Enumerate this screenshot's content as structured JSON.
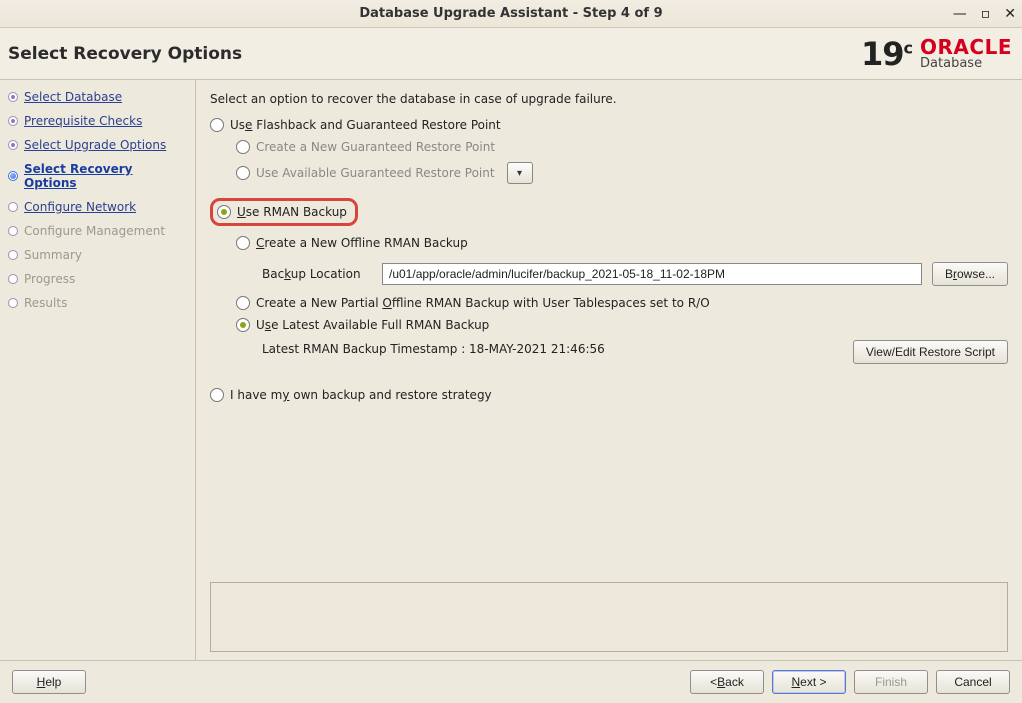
{
  "window": {
    "title": "Database Upgrade Assistant - Step 4 of 9"
  },
  "header": {
    "page_title": "Select Recovery Options",
    "brand_version": "19",
    "brand_version_suffix": "c",
    "brand_line1": "ORACLE",
    "brand_line2": "Database"
  },
  "sidebar": {
    "steps": [
      {
        "label": "Select Database",
        "state": "done",
        "link": true
      },
      {
        "label": "Prerequisite Checks",
        "state": "done",
        "link": true
      },
      {
        "label": "Select Upgrade Options",
        "state": "done",
        "link": true
      },
      {
        "label": "Select Recovery Options",
        "state": "current",
        "link": true
      },
      {
        "label": "Configure Network",
        "state": "upcoming",
        "link": true
      },
      {
        "label": "Configure Management",
        "state": "disabled",
        "link": false
      },
      {
        "label": "Summary",
        "state": "disabled",
        "link": false
      },
      {
        "label": "Progress",
        "state": "disabled",
        "link": false
      },
      {
        "label": "Results",
        "state": "disabled",
        "link": false
      }
    ]
  },
  "main": {
    "intro": "Select an option to recover the database in case of upgrade failure.",
    "opt_flashback": "Use Flashback and Guaranteed Restore Point",
    "opt_flashback_new": "Create a New Guaranteed Restore Point",
    "opt_flashback_avail": "Use Available Guaranteed Restore Point",
    "opt_rman": "Use RMAN Backup",
    "opt_rman_new_offline": "Create a New Offline RMAN Backup",
    "backup_location_label": "Backup Location",
    "backup_location_value": "/u01/app/oracle/admin/lucifer/backup_2021-05-18_11-02-18PM",
    "browse_label": "Browse...",
    "opt_rman_partial": "Create a New Partial Offline RMAN Backup with User Tablespaces set to R/O",
    "opt_rman_latest": "Use Latest Available Full RMAN Backup",
    "latest_timestamp_label": "Latest RMAN Backup Timestamp : 18-MAY-2021 21:46:56",
    "view_script_label": "View/Edit Restore Script",
    "opt_own": "I have my own backup and restore strategy"
  },
  "footer": {
    "help": "Help",
    "back": "< Back",
    "next": "Next >",
    "finish": "Finish",
    "cancel": "Cancel"
  }
}
